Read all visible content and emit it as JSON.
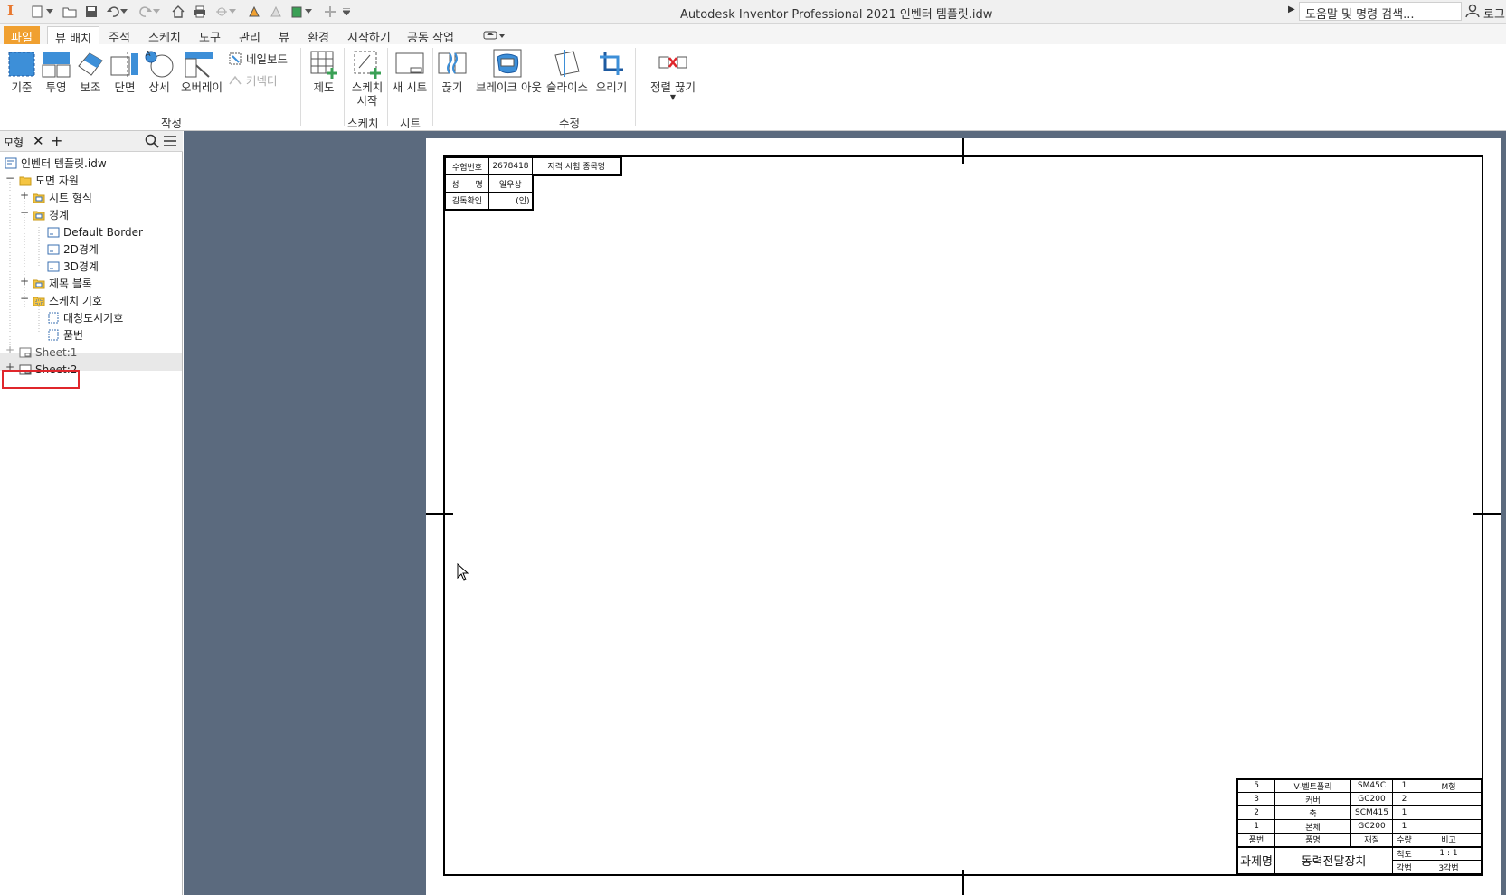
{
  "titlebar": {
    "app_title": "Autodesk Inventor Professional 2021     인벤터 템플릿.idw",
    "search_placeholder": "도움말 및 명령 검색...",
    "login_label": "로그"
  },
  "ribbon_tabs": [
    {
      "label": "파일"
    },
    {
      "label": "뷰 배치"
    },
    {
      "label": "주석"
    },
    {
      "label": "스케치"
    },
    {
      "label": "도구"
    },
    {
      "label": "관리"
    },
    {
      "label": "뷰"
    },
    {
      "label": "환경"
    },
    {
      "label": "시작하기"
    },
    {
      "label": "공동 작업"
    }
  ],
  "ribbon": {
    "create_buttons": [
      "기준",
      "투영",
      "보조",
      "단면",
      "상세",
      "오버레이"
    ],
    "nailboard_label": "네일보드",
    "connector_label": "커넥터",
    "draft_label": "제도",
    "start_sketch_line1": "스케치",
    "start_sketch_line2": "시작",
    "new_sheet_label": "새 시트",
    "modify_buttons": [
      "끊기",
      "브레이크 아웃",
      "슬라이스",
      "오리기"
    ],
    "align_break_label": "정렬 끊기",
    "groups": {
      "create": "작성",
      "sketch": "스케치",
      "sheet": "시트",
      "modify": "수정"
    }
  },
  "browser": {
    "tab_label": "모형",
    "tree": {
      "root": "인벤터 템플릿.idw",
      "drawing_resources": "도면 자원",
      "sheet_formats": "시트 형식",
      "borders": "경계",
      "default_border": "Default Border",
      "border_2d": "2D경계",
      "border_3d": "3D경계",
      "title_blocks": "제목 블록",
      "sketch_symbols": "스케치 기호",
      "symmetry_symbol": "대칭도시기호",
      "item_number": "품번",
      "sheet1": "Sheet:1",
      "sheet2": "Sheet:2"
    }
  },
  "drawing": {
    "top_table": {
      "exam_no_label": "수험번호",
      "exam_no_value": "2678418",
      "exam_title": "지격 시험 종목명",
      "name_label": "성　　명",
      "name_value": "일우상",
      "supervisor_label": "감독확인",
      "supervisor_value": "(인)"
    },
    "parts_list": {
      "rows": [
        {
          "no": "5",
          "name": "V-벨트풀리",
          "material": "SM45C",
          "qty": "1",
          "note": "M형"
        },
        {
          "no": "3",
          "name": "커버",
          "material": "GC200",
          "qty": "2",
          "note": ""
        },
        {
          "no": "2",
          "name": "축",
          "material": "SCM415",
          "qty": "1",
          "note": ""
        },
        {
          "no": "1",
          "name": "본체",
          "material": "GC200",
          "qty": "1",
          "note": ""
        }
      ],
      "header": {
        "no": "품번",
        "name": "품명",
        "material": "재질",
        "qty": "수량",
        "note": "비고"
      }
    },
    "title_block": {
      "project_label": "과제명",
      "project_name": "동력전달장치",
      "scale_label": "척도",
      "scale_value": "1 : 1",
      "projection_label": "각법",
      "projection_value": "3각법"
    }
  },
  "colors": {
    "file_tab": "#f0a030",
    "canvas_bg": "#5b6a7e",
    "highlight_box": "#e0262b"
  }
}
